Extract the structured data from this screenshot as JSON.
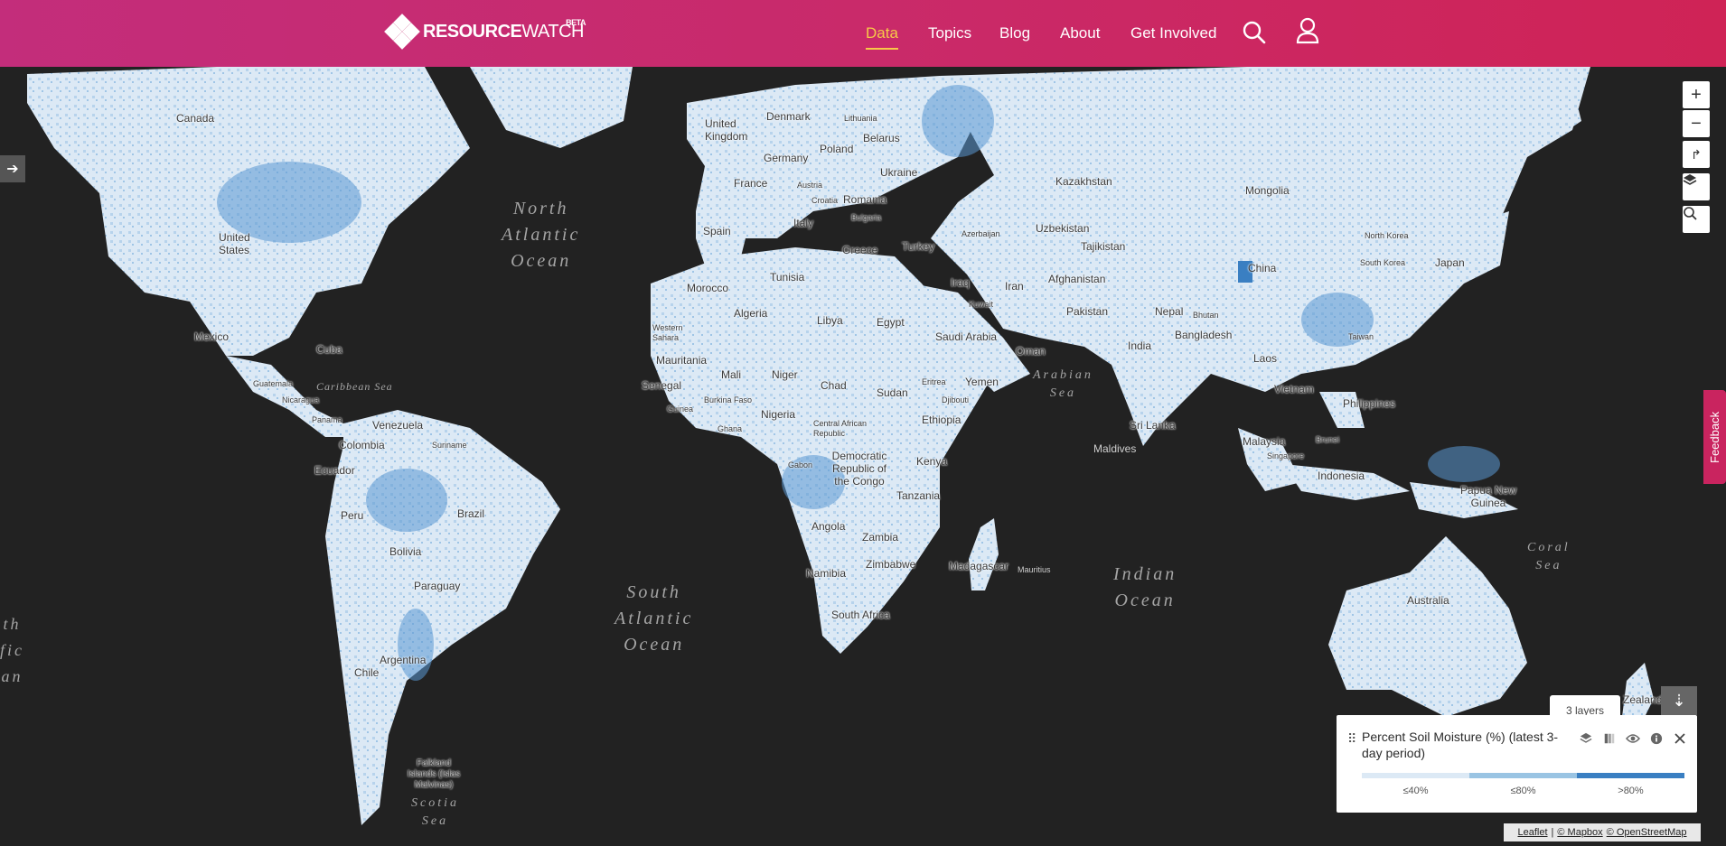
{
  "header": {
    "logo_bold": "RESOURCE",
    "logo_thin": "WATCH",
    "logo_beta": "BETA",
    "nav": [
      {
        "label": "Data",
        "active": true
      },
      {
        "label": "Topics",
        "active": false
      },
      {
        "label": "Blog",
        "active": false
      },
      {
        "label": "About",
        "active": false
      },
      {
        "label": "Get Involved",
        "active": false
      }
    ],
    "icons": [
      "search-icon",
      "user-icon"
    ]
  },
  "map": {
    "controls": [
      "zoom-in-icon",
      "zoom-out-icon",
      "share-icon",
      "basemap-layers-icon",
      "search-location-icon"
    ],
    "ocean_labels": [
      {
        "text": "North\nAtlantic\nOcean"
      },
      {
        "text": "South\nAtlantic\nOcean"
      },
      {
        "text": "Indian\nOcean"
      },
      {
        "text": "Arabian\nSea"
      },
      {
        "text": "Caribbean Sea"
      },
      {
        "text": "Coral\nSea"
      },
      {
        "text": "Scotia\nSea"
      },
      {
        "text": "th\nfic\nan"
      }
    ],
    "country_labels": [
      "Canada",
      "United States",
      "Mexico",
      "Cuba",
      "Guatemala",
      "Nicaragua",
      "Panama",
      "Venezuela",
      "Colombia",
      "Suriname",
      "Ecuador",
      "Peru",
      "Brazil",
      "Bolivia",
      "Paraguay",
      "Chile",
      "Argentina",
      "Falkland Islands (Islas Malvinas)",
      "United Kingdom",
      "Denmark",
      "Lithuania",
      "Belarus",
      "Poland",
      "Germany",
      "France",
      "Austria",
      "Croatia",
      "Romania",
      "Bulgaria",
      "Ukraine",
      "Italy",
      "Spain",
      "Greece",
      "Turkey",
      "Azerbaijan",
      "Kazakhstan",
      "Uzbekistan",
      "Tajikistan",
      "Mongolia",
      "China",
      "North Korea",
      "South Korea",
      "Japan",
      "Afghanistan",
      "Pakistan",
      "Nepal",
      "Bhutan",
      "Bangladesh",
      "India",
      "Iraq",
      "Iran",
      "Kuwait",
      "Saudi Arabia",
      "Oman",
      "Yemen",
      "Tunisia",
      "Morocco",
      "Algeria",
      "Libya",
      "Egypt",
      "Western Sahara",
      "Mauritania",
      "Mali",
      "Niger",
      "Chad",
      "Sudan",
      "Eritrea",
      "Djibouti",
      "Senegal",
      "Burkina Faso",
      "Guinea",
      "Ghana",
      "Nigeria",
      "Central African Republic",
      "Ethiopia",
      "Democratic Republic of the Congo",
      "Gabon",
      "Kenya",
      "Tanzania",
      "Angola",
      "Zambia",
      "Namibia",
      "Zimbabwe",
      "South Africa",
      "Madagascar",
      "Mauritius",
      "Maldives",
      "Sri Lanka",
      "Laos",
      "Vietnam",
      "Taiwan",
      "Philippines",
      "Malaysia",
      "Singapore",
      "Brunei",
      "Indonesia",
      "Papua New Guinea",
      "Australia",
      "Zealand"
    ],
    "feedback_label": "Feedback",
    "sidebar_toggle_icon": "arrow-right-icon"
  },
  "legend": {
    "layers_tooltip": "3 layers",
    "title": "Percent Soil Moisture (%) (latest 3-day period)",
    "tools": [
      "layers-icon",
      "opacity-icon",
      "visibility-eye-icon",
      "info-icon",
      "close-icon"
    ],
    "collapse_icon": "arrow-down-icon",
    "items": [
      {
        "label": "≤40%",
        "color": "#dce9f5"
      },
      {
        "label": "≤80%",
        "color": "#9ac4e3"
      },
      {
        "label": ">80%",
        "color": "#3a7fc2"
      }
    ]
  },
  "attribution": {
    "leaflet": "Leaflet",
    "sep": "|",
    "mapbox": "© Mapbox",
    "osm": "© OpenStreetMap"
  },
  "colors": {
    "header_start": "#c32d7b",
    "header_end": "#cf2356",
    "nav_active": "#f7c948",
    "land_base": "#dce9f5",
    "ocean": "#222222"
  }
}
